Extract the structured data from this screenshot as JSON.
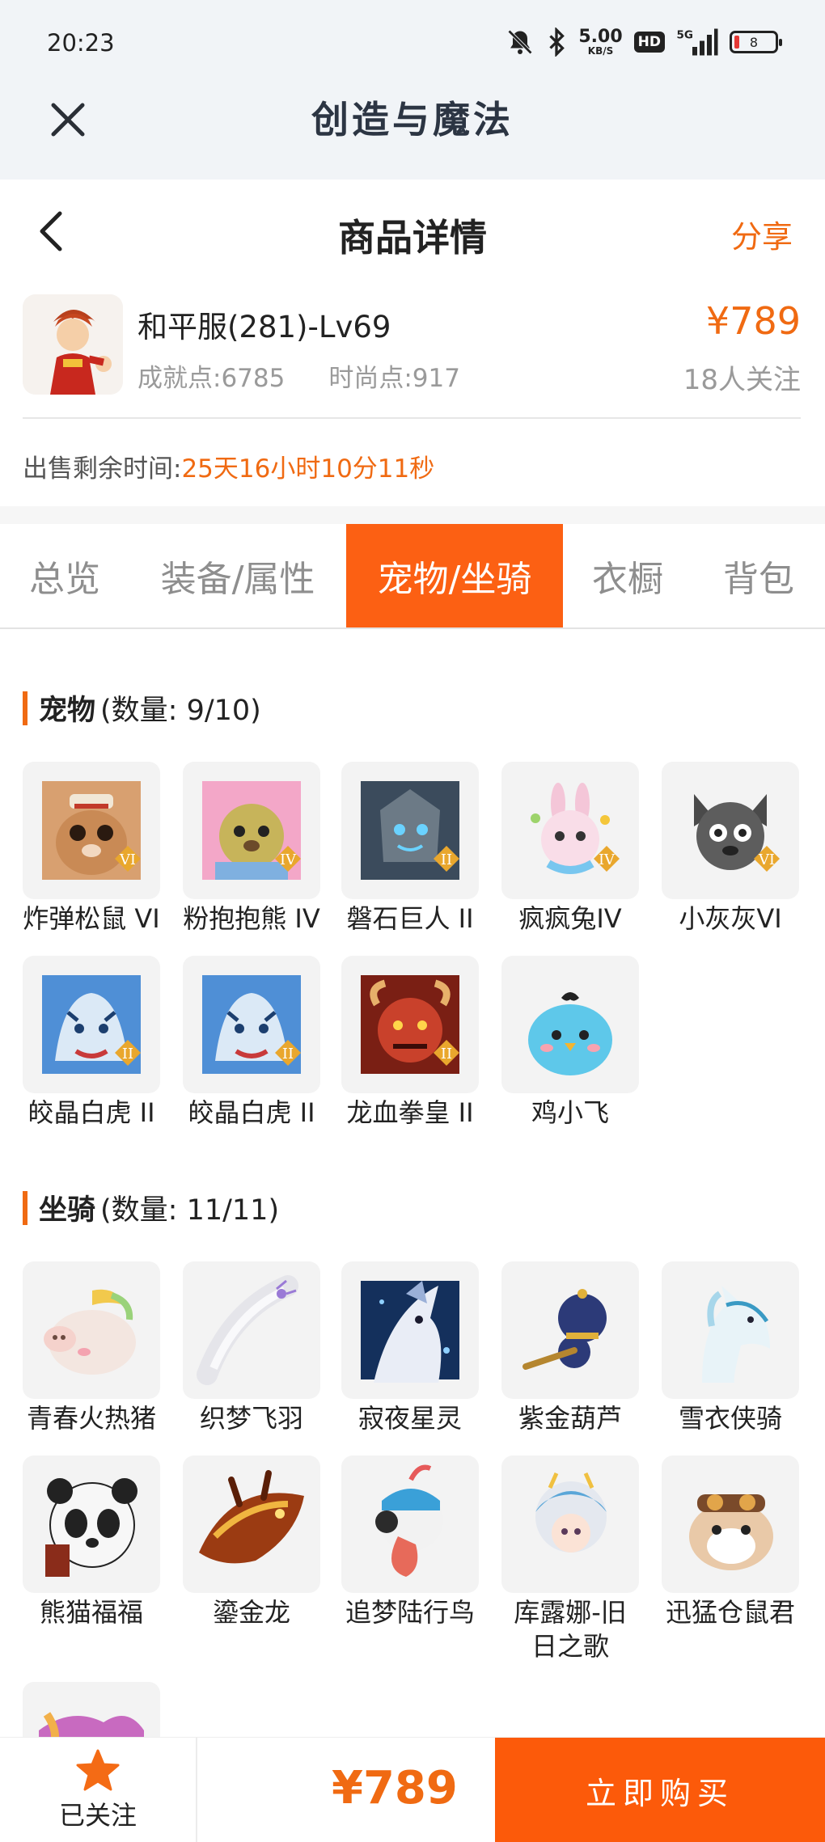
{
  "status_bar": {
    "time": "20:23",
    "net_speed_value": "5.00",
    "net_speed_unit": "KB/S",
    "hd_label": "HD",
    "network_label": "5G",
    "battery_level": "8",
    "icons": [
      "mute-bell-icon",
      "bluetooth-icon",
      "signal-icon",
      "battery-icon"
    ]
  },
  "app_header": {
    "title": "创造与魔法",
    "close_icon": "close-icon"
  },
  "page_header": {
    "title": "商品详情",
    "share_label": "分享",
    "back_icon": "chevron-left-icon"
  },
  "product": {
    "name": "和平服(281)-Lv69",
    "achievement": "成就点:6785",
    "fashion": "时尚点:917",
    "price": "¥789",
    "followers": "18人关注",
    "remaining_label": "出售剩余时间:",
    "remaining_value": "25天16小时10分11秒"
  },
  "tabs": [
    {
      "label": "总览",
      "active": false
    },
    {
      "label": "装备/属性",
      "active": false
    },
    {
      "label": "宠物/坐骑",
      "active": true
    },
    {
      "label": "衣橱",
      "active": false
    },
    {
      "label": "背包",
      "active": false
    }
  ],
  "pets": {
    "title": "宠物",
    "count": "(数量: 9/10)",
    "items": [
      {
        "name": "炸弹松鼠 VI",
        "badge": "VI"
      },
      {
        "name": "粉抱抱熊 IV",
        "badge": "IV"
      },
      {
        "name": "磐石巨人 II",
        "badge": "II"
      },
      {
        "name": "疯疯兔IV",
        "badge": "IV"
      },
      {
        "name": "小灰灰VI",
        "badge": "VI"
      },
      {
        "name": "皎晶白虎 II",
        "badge": "II"
      },
      {
        "name": "皎晶白虎 II",
        "badge": "II"
      },
      {
        "name": "龙血拳皇 II",
        "badge": "II"
      },
      {
        "name": "鸡小飞",
        "badge": ""
      }
    ]
  },
  "mounts": {
    "title": "坐骑",
    "count": "(数量: 11/11)",
    "items": [
      {
        "name": "青春火热猪"
      },
      {
        "name": "织梦飞羽"
      },
      {
        "name": "寂夜星灵"
      },
      {
        "name": "紫金葫芦"
      },
      {
        "name": "雪衣侠骑"
      },
      {
        "name": "熊猫福福"
      },
      {
        "name": "鎏金龙"
      },
      {
        "name": "追梦陆行鸟"
      },
      {
        "name": "库露娜-旧日之歌"
      },
      {
        "name": "迅猛仓鼠君"
      },
      {
        "name": ""
      }
    ]
  },
  "bottom_bar": {
    "follow_label": "已关注",
    "price": "¥789",
    "buy_label": "立即购买"
  },
  "colors": {
    "accent": "#fc6013",
    "price": "#f06a12",
    "header_bg": "#f1f4f7"
  }
}
